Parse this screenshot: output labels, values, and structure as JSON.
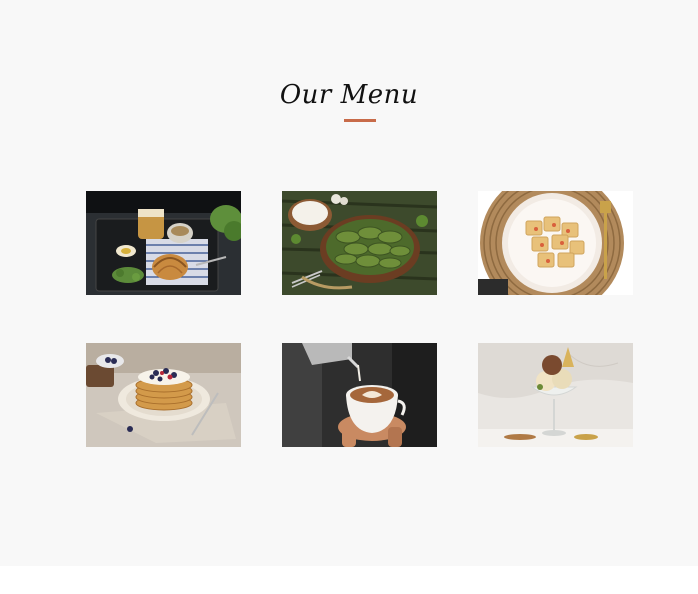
{
  "section": {
    "title": "Our Menu",
    "accent_color": "#c86b49",
    "background": "#f8f8f8"
  },
  "menu_items": [
    {
      "icon": "breakfast-croissant-photo"
    },
    {
      "icon": "stuffed-grape-leaves-photo"
    },
    {
      "icon": "ravioli-pasta-photo"
    },
    {
      "icon": "pancake-stack-photo"
    },
    {
      "icon": "latte-art-coffee-photo"
    },
    {
      "icon": "ice-cream-sundae-photo"
    }
  ]
}
